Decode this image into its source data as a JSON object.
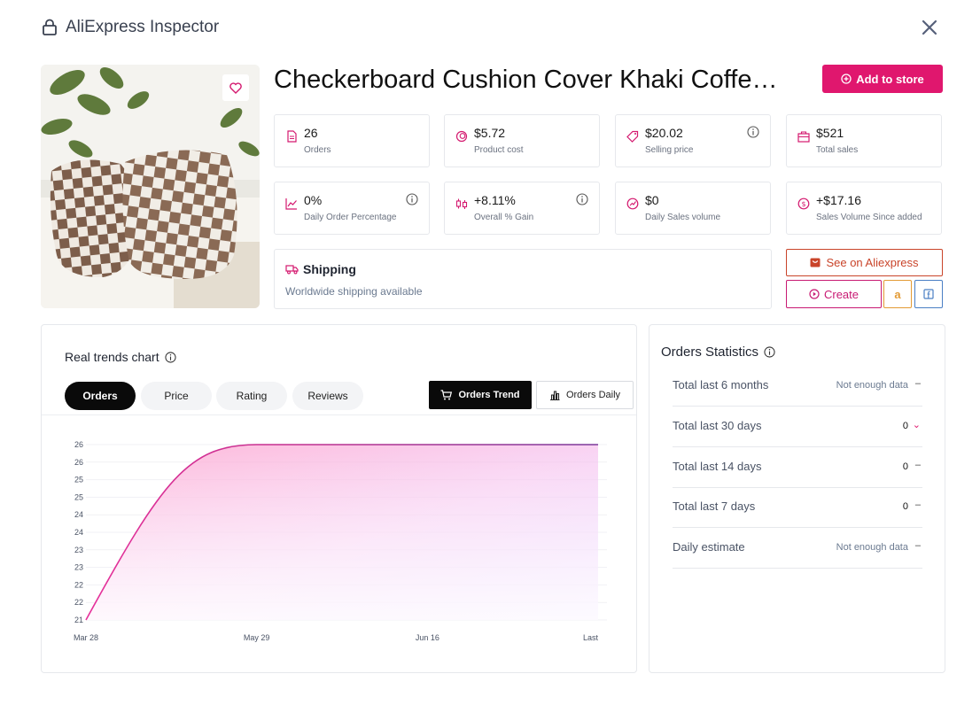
{
  "header": {
    "title": "AliExpress Inspector"
  },
  "product": {
    "title": "Checkerboard Cushion Cover Khaki Coffee Plaid Pillow Cover"
  },
  "actions": {
    "add_to_store": "Add to store",
    "see_on": "See on Aliexpress",
    "create": "Create",
    "amazon_icon_glyph": "a"
  },
  "stats": [
    {
      "value": "26",
      "label": "Orders",
      "icon": "document-icon",
      "info": false
    },
    {
      "value": "$5.72",
      "label": "Product cost",
      "icon": "coins-icon",
      "info": false
    },
    {
      "value": "$20.02",
      "label": "Selling price",
      "icon": "tag-icon",
      "info": true
    },
    {
      "value": "$521",
      "label": "Total sales",
      "icon": "briefcase-icon",
      "info": false
    },
    {
      "value": "0%",
      "label": "Daily Order Percentage",
      "icon": "line-chart-icon",
      "info": true
    },
    {
      "value": "+8.11%",
      "label": "Overall % Gain",
      "icon": "candlestick-icon",
      "info": true
    },
    {
      "value": "$0",
      "label": "Daily Sales volume",
      "icon": "gauge-icon",
      "info": false
    },
    {
      "value": "+$17.16",
      "label": "Sales Volume Since added",
      "icon": "dollar-circle-icon",
      "info": false
    }
  ],
  "shipping": {
    "title": "Shipping",
    "subtitle": "Worldwide shipping available"
  },
  "chart_panel": {
    "title": "Real trends chart",
    "tabs": [
      "Orders",
      "Price",
      "Rating",
      "Reviews"
    ],
    "active_tab": "Orders",
    "trend_buttons": [
      "Orders Trend",
      "Orders Daily"
    ],
    "active_trend": "Orders Trend"
  },
  "chart_data": {
    "type": "area",
    "x": [
      "Mar 28",
      "May 29",
      "Jun 16",
      "Last"
    ],
    "values": [
      21,
      26,
      26,
      26
    ],
    "y_tick_labels": [
      "26",
      "26",
      "25",
      "25",
      "24",
      "24",
      "23",
      "23",
      "22",
      "22",
      "21"
    ],
    "ylim": [
      21,
      26
    ],
    "grid": true,
    "colors": {
      "line": "#d42f9a",
      "fill_start": "#ff9fc8",
      "fill_end": "#d7a6ff",
      "line_end": "#8a3fa6"
    }
  },
  "orders_statistics": {
    "title": "Orders Statistics",
    "rows": [
      {
        "label": "Total last 6 months",
        "value": "Not enough data",
        "trend": "–",
        "muted": true,
        "down": false
      },
      {
        "label": "Total last 30 days",
        "value": "0",
        "trend": "⌄",
        "muted": false,
        "down": true
      },
      {
        "label": "Total last 14 days",
        "value": "0",
        "trend": "–",
        "muted": false,
        "down": false
      },
      {
        "label": "Total last 7 days",
        "value": "0",
        "trend": "–",
        "muted": false,
        "down": false
      },
      {
        "label": "Daily estimate",
        "value": "Not enough data",
        "trend": "–",
        "muted": true,
        "down": false
      }
    ]
  },
  "colors": {
    "brand": "#e0176e",
    "aliexpress": "#c9442a",
    "amazon": "#e39b35",
    "facebook": "#4a7fc4"
  }
}
